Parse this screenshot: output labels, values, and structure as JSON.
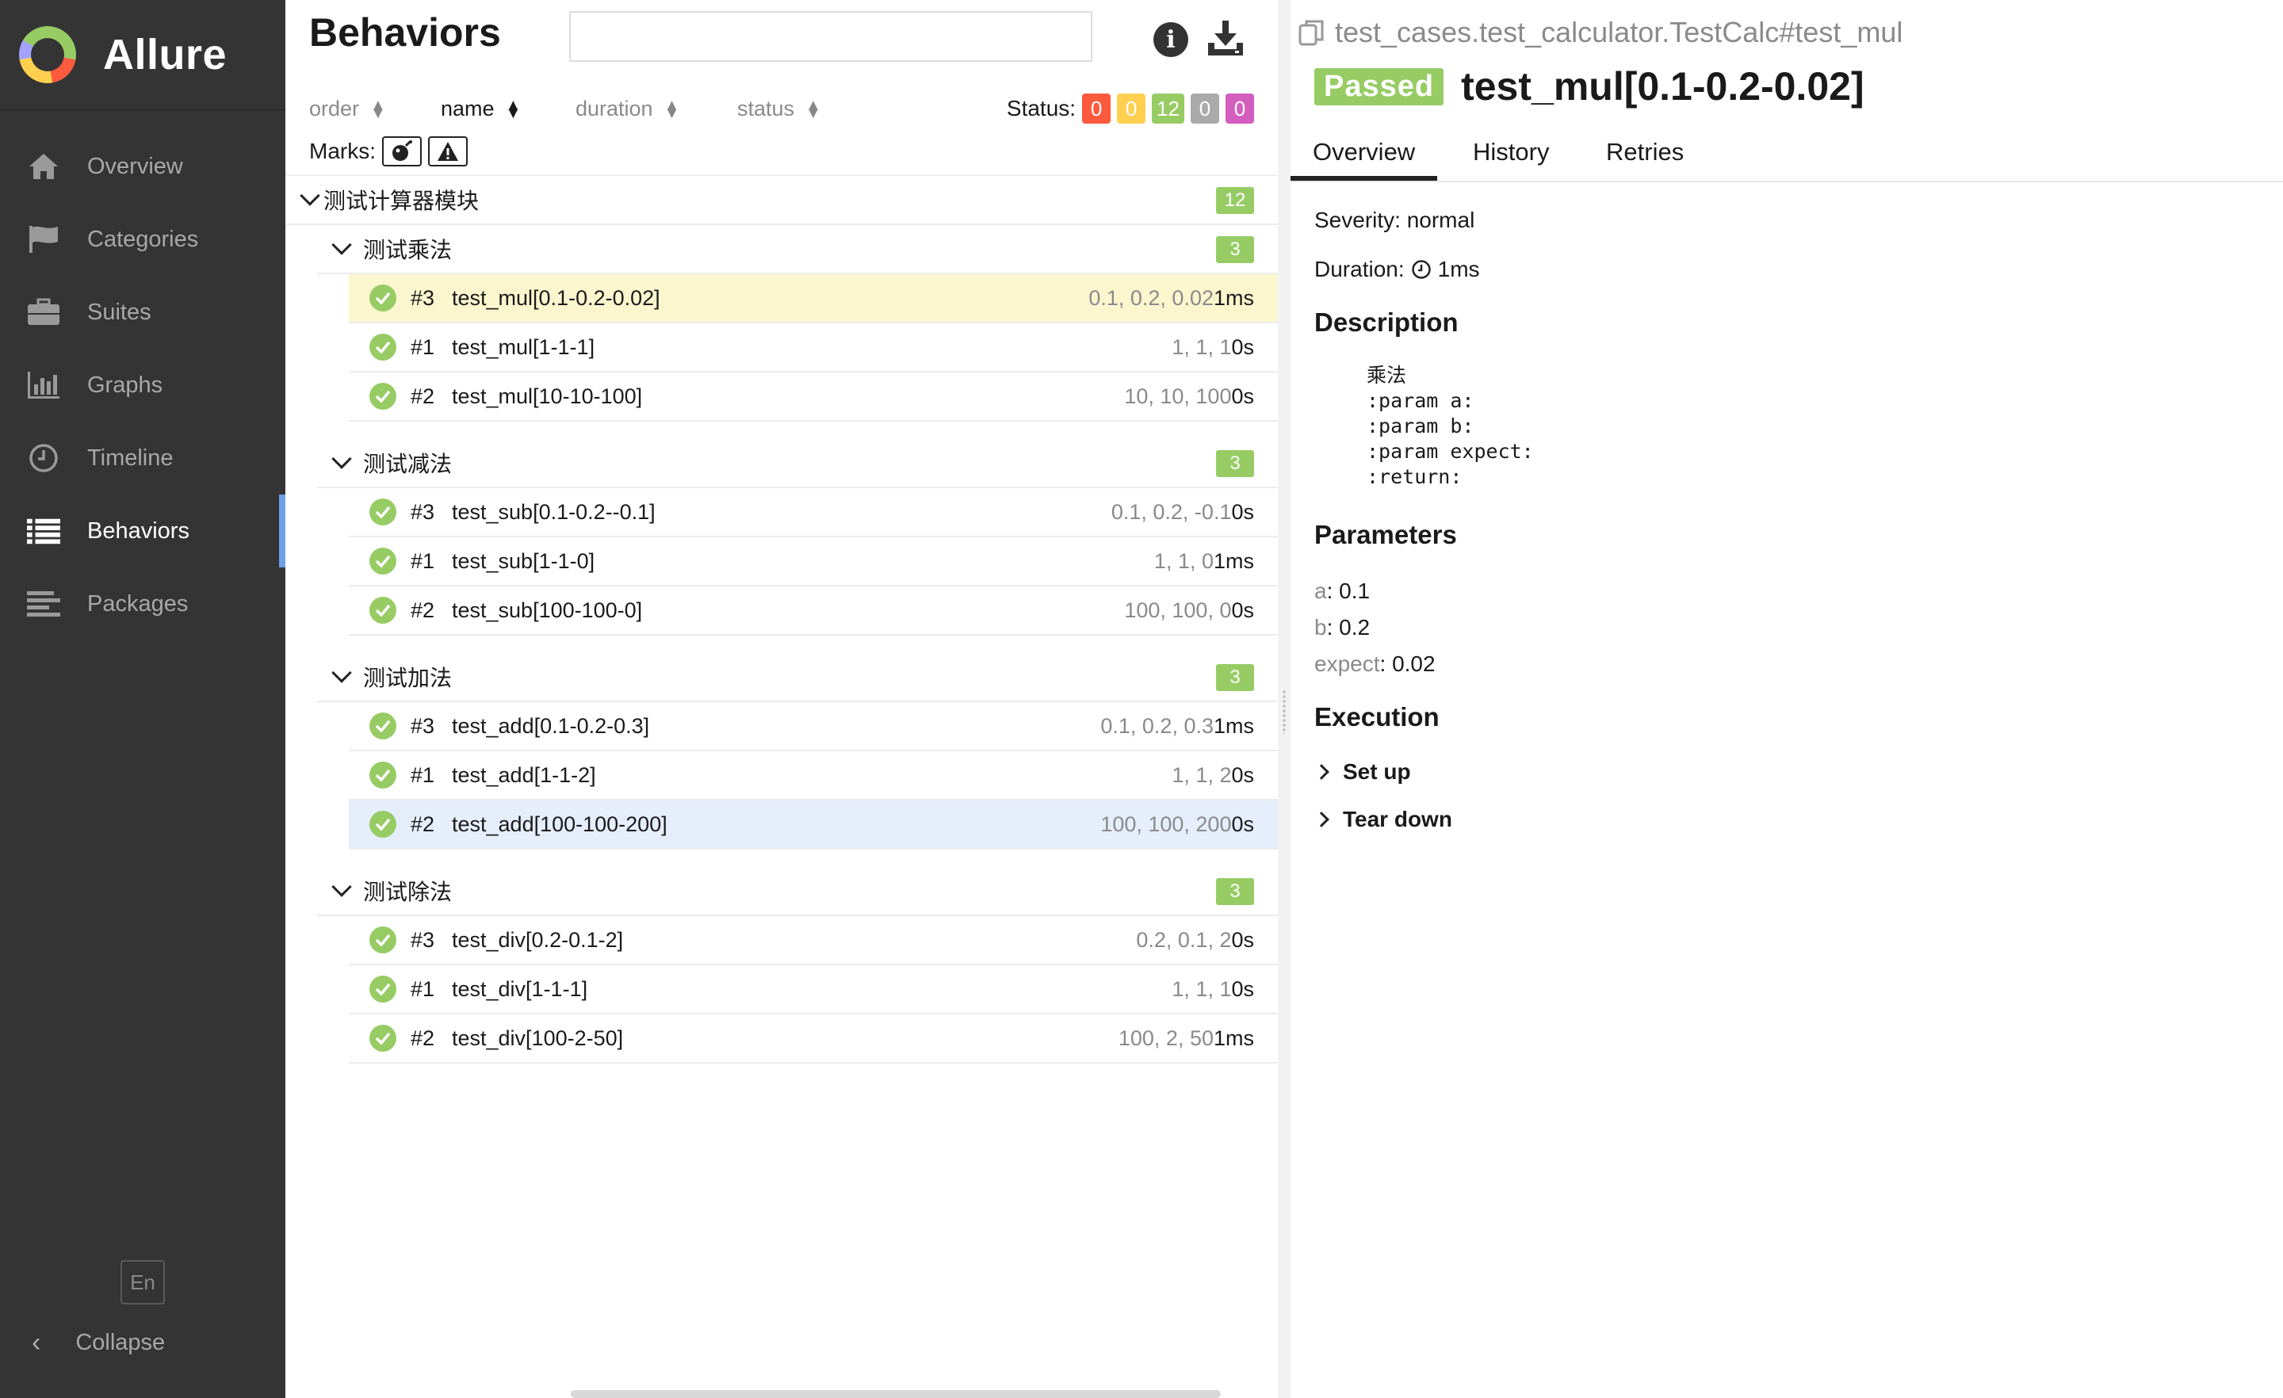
{
  "brand": {
    "name": "Allure"
  },
  "sidebar": {
    "items": [
      {
        "label": "Overview",
        "icon": "home-icon",
        "active": false
      },
      {
        "label": "Categories",
        "icon": "flag-icon",
        "active": false
      },
      {
        "label": "Suites",
        "icon": "briefcase-icon",
        "active": false
      },
      {
        "label": "Graphs",
        "icon": "bar-chart-icon",
        "active": false
      },
      {
        "label": "Timeline",
        "icon": "clock-icon",
        "active": false
      },
      {
        "label": "Behaviors",
        "icon": "list-icon",
        "active": true
      },
      {
        "label": "Packages",
        "icon": "align-left-icon",
        "active": false
      }
    ],
    "language": "En",
    "collapse_label": "Collapse"
  },
  "behaviors": {
    "title": "Behaviors",
    "search": {
      "value": "",
      "placeholder": ""
    },
    "sort": {
      "order": "order",
      "name": "name",
      "duration": "duration",
      "status": "status"
    },
    "status_label": "Status:",
    "status_counts": [
      {
        "name": "failed",
        "count": "0",
        "color": "#fd5a3e"
      },
      {
        "name": "broken",
        "count": "0",
        "color": "#ffd050"
      },
      {
        "name": "passed",
        "count": "12",
        "color": "#97cc64"
      },
      {
        "name": "skipped",
        "count": "0",
        "color": "#aaaaaa"
      },
      {
        "name": "unknown",
        "count": "0",
        "color": "#d35ebe"
      }
    ],
    "marks_label": "Marks:",
    "root": {
      "name": "测试计算器模块",
      "count": "12"
    },
    "groups": [
      {
        "name": "测试乘法",
        "count": "3",
        "tests": [
          {
            "num": "#3",
            "name": "test_mul[0.1-0.2-0.02]",
            "params": "0.1, 0.2, 0.02",
            "duration": "1ms"
          },
          {
            "num": "#1",
            "name": "test_mul[1-1-1]",
            "params": "1, 1, 1",
            "duration": "0s"
          },
          {
            "num": "#2",
            "name": "test_mul[10-10-100]",
            "params": "10, 10, 100",
            "duration": "0s"
          }
        ]
      },
      {
        "name": "测试减法",
        "count": "3",
        "tests": [
          {
            "num": "#3",
            "name": "test_sub[0.1-0.2--0.1]",
            "params": "0.1, 0.2, -0.1",
            "duration": "0s"
          },
          {
            "num": "#1",
            "name": "test_sub[1-1-0]",
            "params": "1, 1, 0",
            "duration": "1ms"
          },
          {
            "num": "#2",
            "name": "test_sub[100-100-0]",
            "params": "100, 100, 0",
            "duration": "0s"
          }
        ]
      },
      {
        "name": "测试加法",
        "count": "3",
        "tests": [
          {
            "num": "#3",
            "name": "test_add[0.1-0.2-0.3]",
            "params": "0.1, 0.2, 0.3",
            "duration": "1ms"
          },
          {
            "num": "#1",
            "name": "test_add[1-1-2]",
            "params": "1, 1, 2",
            "duration": "0s"
          },
          {
            "num": "#2",
            "name": "test_add[100-100-200]",
            "params": "100, 100, 200",
            "duration": "0s"
          }
        ]
      },
      {
        "name": "测试除法",
        "count": "3",
        "tests": [
          {
            "num": "#3",
            "name": "test_div[0.2-0.1-2]",
            "params": "0.2, 0.1, 2",
            "duration": "0s"
          },
          {
            "num": "#1",
            "name": "test_div[1-1-1]",
            "params": "1, 1, 1",
            "duration": "0s"
          },
          {
            "num": "#2",
            "name": "test_div[100-2-50]",
            "params": "100, 2, 50",
            "duration": "1ms"
          }
        ]
      }
    ]
  },
  "detail": {
    "breadcrumb": "test_cases.test_calculator.TestCalc#test_mul",
    "status": "Passed",
    "status_color": "#97cc64",
    "title": "test_mul[0.1-0.2-0.02]",
    "tabs": [
      "Overview",
      "History",
      "Retries"
    ],
    "severity": "Severity: normal",
    "duration_label": "Duration:",
    "duration_value": "1ms",
    "description_title": "Description",
    "description_body": "乘法\n:param a:\n:param b:\n:param expect:\n:return:",
    "parameters_title": "Parameters",
    "parameters": [
      {
        "key": "a",
        "value": "0.1"
      },
      {
        "key": "b",
        "value": "0.2"
      },
      {
        "key": "expect",
        "value": "0.02"
      }
    ],
    "execution_title": "Execution",
    "execution": [
      "Set up",
      "Tear down"
    ]
  }
}
